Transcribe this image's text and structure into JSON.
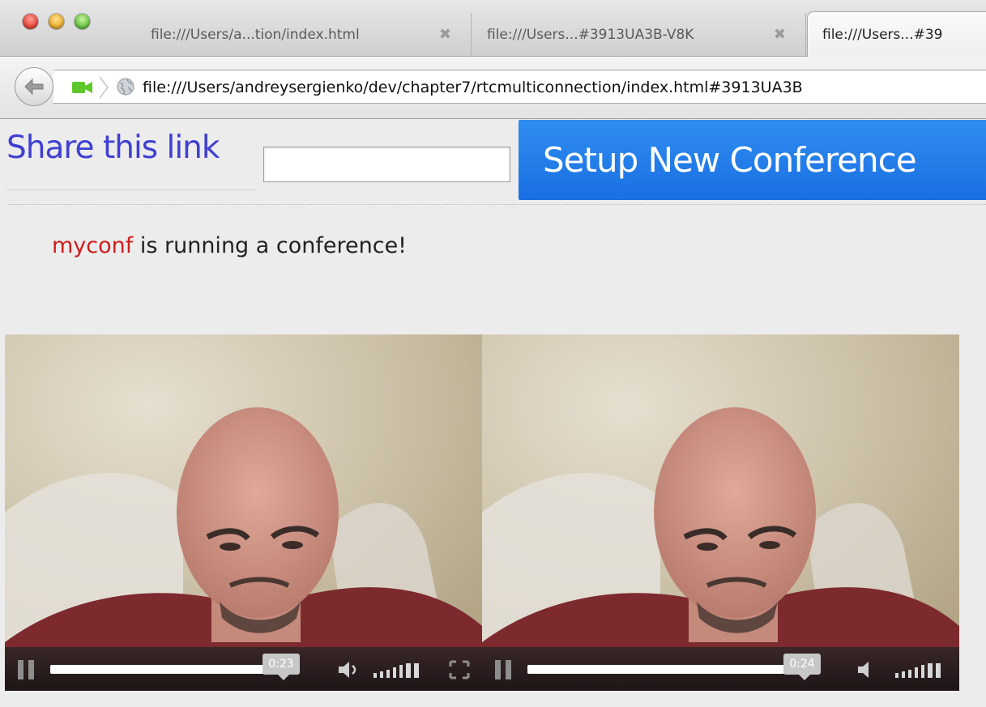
{
  "browser": {
    "tabs": [
      {
        "label": "file:///Users/a...tion/index.html",
        "active": false
      },
      {
        "label": "file:///Users...#3913UA3B-V8K",
        "active": false
      },
      {
        "label": "file:///Users...#39",
        "active": true
      }
    ],
    "tab_close_glyph": "✖",
    "address": "file:///Users/andreysergienko/dev/chapter7/rtcmulticonnection/index.html#3913UA3B"
  },
  "page": {
    "share_label": "Share this link",
    "share_input_value": "",
    "setup_button": "Setup New Conference",
    "status_user": "myconf",
    "status_text": " is running a conference!"
  },
  "videos": [
    {
      "time": "0:23",
      "progress": 0.6,
      "muted": false
    },
    {
      "time": "0:24",
      "progress": 0.6,
      "muted": true
    }
  ],
  "colors": {
    "share_link": "#3f3fd2",
    "setup_button": "#1f78e8",
    "status_user": "#d11c1c"
  },
  "icons": [
    "back-arrow-icon",
    "video-camera-icon",
    "globe-icon",
    "pause-icon",
    "volume-icon",
    "volume-level-icon",
    "fullscreen-icon",
    "close-icon"
  ]
}
